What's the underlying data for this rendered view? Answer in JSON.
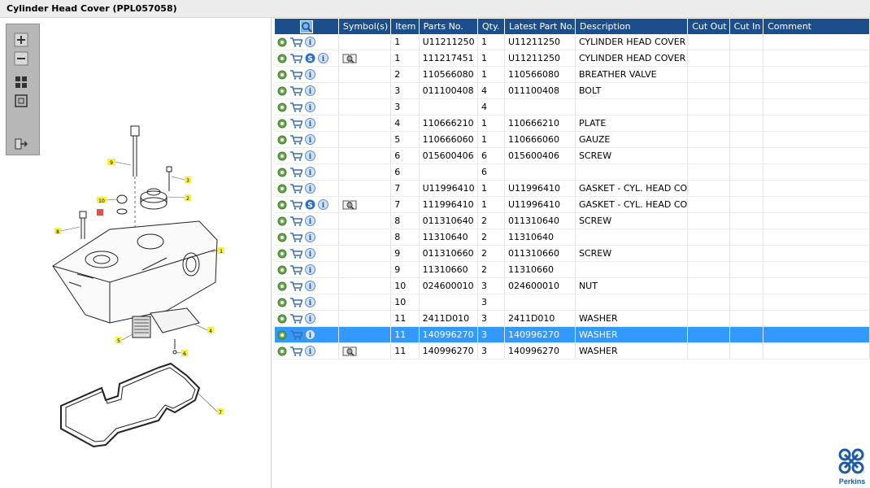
{
  "window": {
    "title": "Cylinder Head Cover (PPL057058)"
  },
  "toolbar": {
    "buttons": [
      "zoom-in-icon",
      "zoom-out-icon",
      "fit-page-icon",
      "actual-size-icon",
      "export-icon"
    ]
  },
  "diagram": {
    "callouts": [
      "1",
      "2",
      "3",
      "4",
      "5",
      "6",
      "7",
      "8",
      "9",
      "10"
    ]
  },
  "table": {
    "columns": [
      "",
      "Symbol(s)",
      "Item",
      "Parts No.",
      "Qty.",
      "Latest Part No.",
      "Description",
      "Cut Out",
      "Cut In",
      "Comment"
    ],
    "rows": [
      {
        "s": false,
        "b": false,
        "item": "1",
        "part": "U11211250",
        "qty": "1",
        "latest": "U11211250",
        "desc": "CYLINDER HEAD COVER"
      },
      {
        "s": true,
        "b": true,
        "item": "1",
        "part": "111217451",
        "qty": "1",
        "latest": "U11211250",
        "desc": "CYLINDER HEAD COVER"
      },
      {
        "s": false,
        "b": false,
        "item": "2",
        "part": "110566080",
        "qty": "1",
        "latest": "110566080",
        "desc": "BREATHER VALVE"
      },
      {
        "s": false,
        "b": false,
        "item": "3",
        "part": "011100408",
        "qty": "4",
        "latest": "011100408",
        "desc": "BOLT"
      },
      {
        "s": false,
        "b": false,
        "item": "3",
        "part": "",
        "qty": "4",
        "latest": "",
        "desc": ""
      },
      {
        "s": false,
        "b": false,
        "item": "4",
        "part": "110666210",
        "qty": "1",
        "latest": "110666210",
        "desc": "PLATE"
      },
      {
        "s": false,
        "b": false,
        "item": "5",
        "part": "110666060",
        "qty": "1",
        "latest": "110666060",
        "desc": "GAUZE"
      },
      {
        "s": false,
        "b": false,
        "item": "6",
        "part": "015600406",
        "qty": "6",
        "latest": "015600406",
        "desc": "SCREW"
      },
      {
        "s": false,
        "b": false,
        "item": "6",
        "part": "",
        "qty": "6",
        "latest": "",
        "desc": ""
      },
      {
        "s": false,
        "b": false,
        "item": "7",
        "part": "U11996410",
        "qty": "1",
        "latest": "U11996410",
        "desc": "GASKET - CYL. HEAD CO"
      },
      {
        "s": true,
        "b": true,
        "item": "7",
        "part": "111996410",
        "qty": "1",
        "latest": "U11996410",
        "desc": "GASKET - CYL. HEAD CO"
      },
      {
        "s": false,
        "b": false,
        "item": "8",
        "part": "011310640",
        "qty": "2",
        "latest": "011310640",
        "desc": "SCREW"
      },
      {
        "s": false,
        "b": false,
        "item": "8",
        "part": "11310640",
        "qty": "2",
        "latest": "11310640",
        "desc": ""
      },
      {
        "s": false,
        "b": false,
        "item": "9",
        "part": "011310660",
        "qty": "2",
        "latest": "011310660",
        "desc": "SCREW"
      },
      {
        "s": false,
        "b": false,
        "item": "9",
        "part": "11310660",
        "qty": "2",
        "latest": "11310660",
        "desc": ""
      },
      {
        "s": false,
        "b": false,
        "item": "10",
        "part": "024600010",
        "qty": "3",
        "latest": "024600010",
        "desc": "NUT"
      },
      {
        "s": false,
        "b": false,
        "item": "10",
        "part": "",
        "qty": "3",
        "latest": "",
        "desc": ""
      },
      {
        "s": false,
        "b": false,
        "item": "11",
        "part": "2411D010",
        "qty": "3",
        "latest": "2411D010",
        "desc": "WASHER"
      },
      {
        "s": false,
        "b": false,
        "item": "11",
        "part": "140996270",
        "qty": "3",
        "latest": "140996270",
        "desc": "WASHER",
        "selected": true
      },
      {
        "s": false,
        "b": true,
        "item": "11",
        "part": "140996270",
        "qty": "3",
        "latest": "140996270",
        "desc": "WASHER"
      }
    ]
  },
  "brand": {
    "name": "Perkins",
    "color": "#1c5aa6"
  },
  "colors": {
    "header": "#1c4e8c",
    "selection": "#3399ff"
  }
}
